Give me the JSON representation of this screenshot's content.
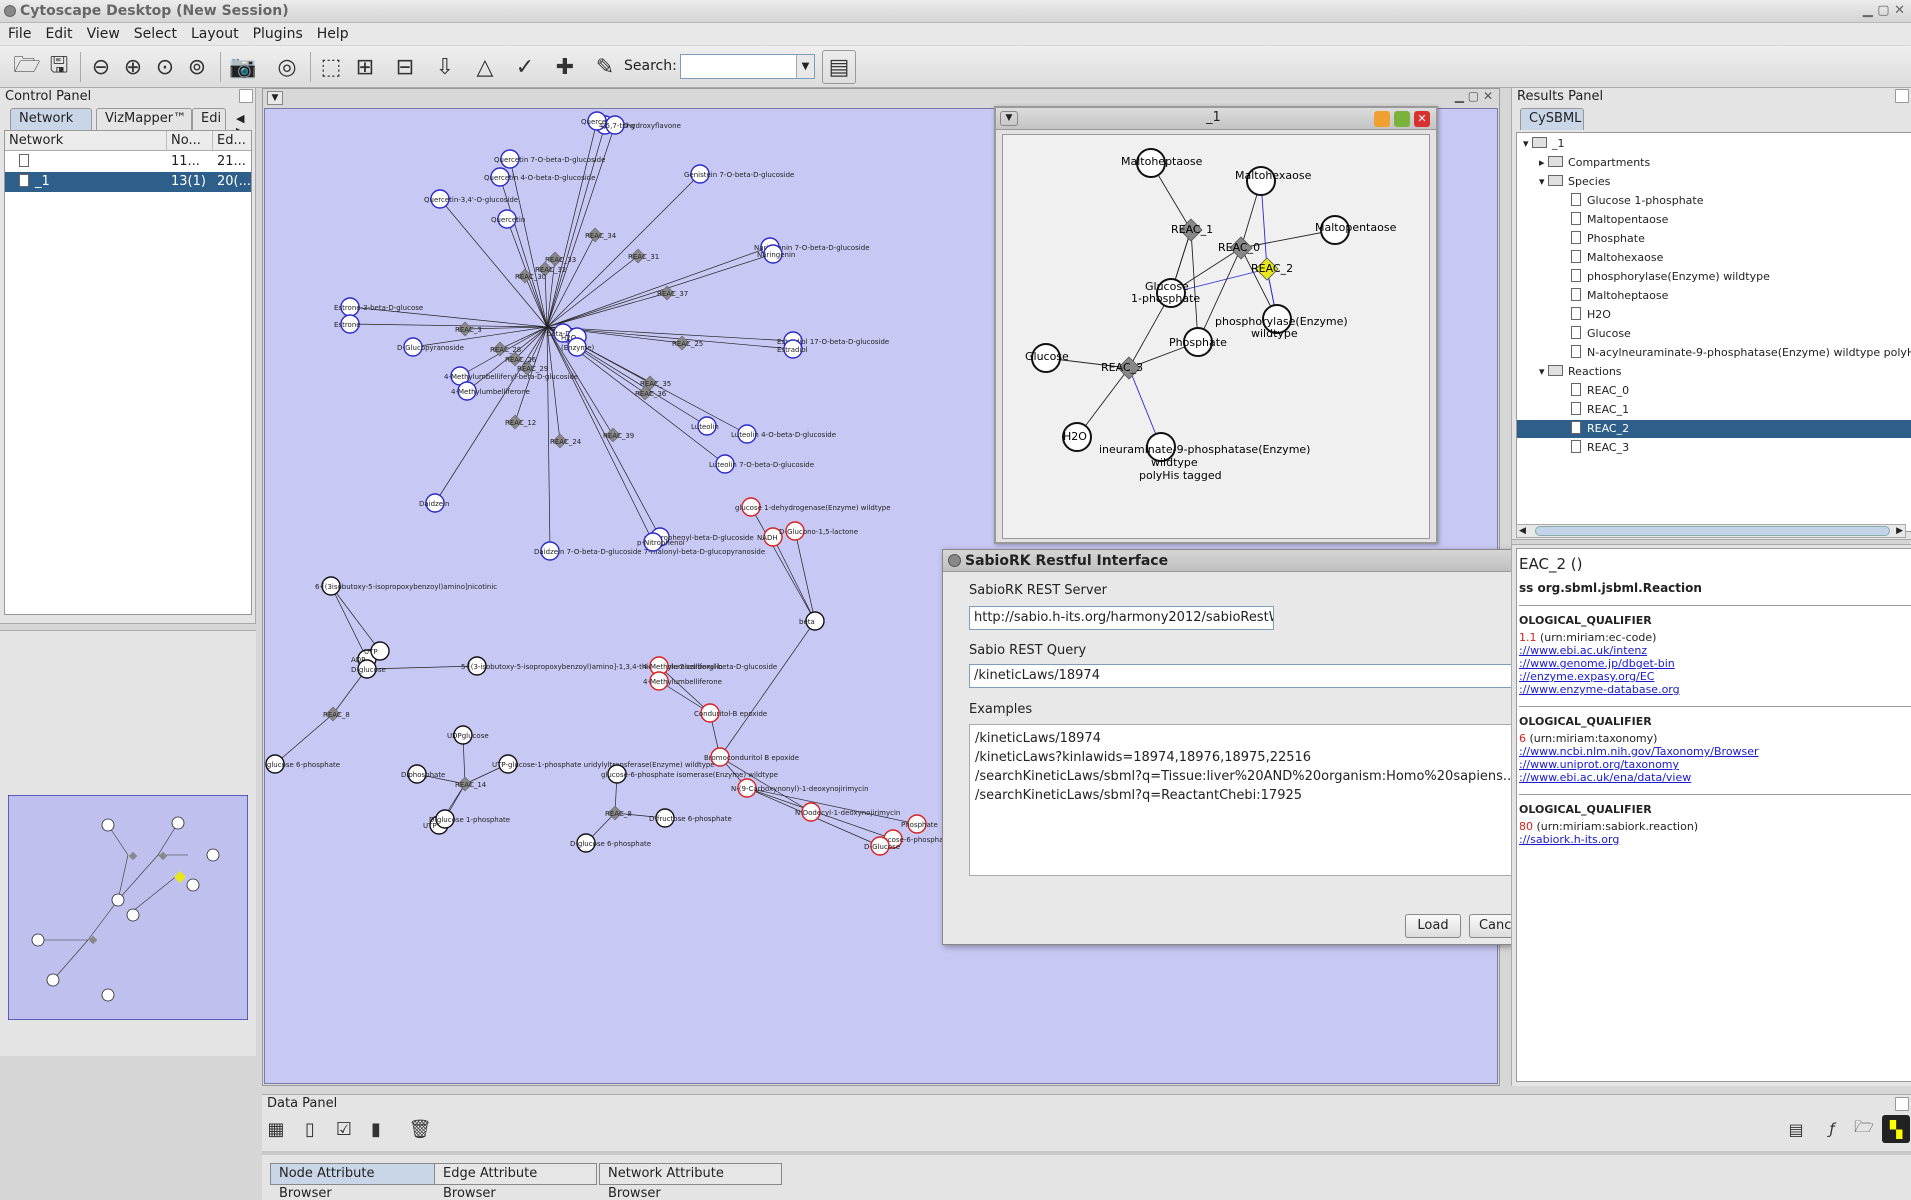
{
  "window": {
    "title": "Cytoscape Desktop (New Session)"
  },
  "menu": [
    "File",
    "Edit",
    "View",
    "Select",
    "Layout",
    "Plugins",
    "Help"
  ],
  "toolbar": {
    "search_label": "Search:",
    "search_value": ""
  },
  "control_panel": {
    "title": "Control Panel",
    "tabs": [
      "Network",
      "VizMapper™",
      "Edi"
    ],
    "table_headers": [
      "Network",
      "No...",
      "Ed..."
    ],
    "rows": [
      {
        "name": "",
        "nodes": "11...",
        "edges": "21..."
      },
      {
        "name": "_1",
        "nodes": "13(1)",
        "edges": "20(..."
      }
    ]
  },
  "subnet_window": {
    "title": "_1"
  },
  "main_graph": {
    "nodes": [
      "7-O-beta-D-g",
      "Quercetin",
      "4,5,7-trihydroxyflavone",
      "Quercetin 7-O-beta-D-glucoside",
      "Quercetin 4-O-beta-D-glucoside",
      "Quercetin-3,4'-O-glucoside",
      "Quercetin",
      "Genistein 7-O-beta-D-glucoside",
      "Naringenin 7-O-beta-D-glucoside",
      "Naringenin",
      "REAC_33",
      "REAC_34",
      "REAC_31",
      "REAC_32",
      "REAC_30",
      "REAC_37",
      "REAC_3",
      "REAC_35",
      "REAC_25",
      "REAC_28",
      "REAC_29",
      "REAC_26",
      "REAC_12",
      "REAC_24",
      "REAC_39",
      "REAC_36",
      "Estrone-3-beta-D-glucose",
      "Estrone",
      "D-Glucopyranoside",
      "4-Methylumbelliferyl-beta-D-glucoside",
      "4-Methylumbelliferone",
      "beta-D-",
      "H2O",
      "(Enzyme)",
      "Estradiol 17-O-beta-D-glucoside",
      "Estradiol",
      "Luteolin",
      "Luteolin 4-O-beta-D-glucoside",
      "Luteolin 7-O-beta-D-glucoside",
      "Daidzein",
      "Daidzein 7-O-beta-D-glucoside 7-malonyl-beta-D-glucopyranoside",
      "p-Nitrophenyl-beta-D-glucoside",
      "p-Nitrophenol",
      "6-[(3isobutoxy-5-isopropoxybenzoyl)amino]nicotinic",
      "5-[(3-isobutoxy-5-isopropoxybenzoyl)amino]-1,3,4-thiadiazole-2-carboxylic",
      "ADP",
      "UTP",
      "D-glucose",
      "REAC_8",
      "D-glucose 6-phosphate",
      "UDPglucose",
      "UTP-glucose-1-phosphate uridylyltransferase(Enzyme) wildtype",
      "Diphosphate",
      "REAC_14",
      "UTP",
      "D-glucose 1-phosphate",
      "glucose-6-phosphate isomerase(Enzyme) wildtype",
      "REAC_8",
      "D-glucose 6-phosphate",
      "D-fructose 6-phosphate",
      "4-Methylumbelliferyl-beta-D-glucoside",
      "4-Methylumbelliferone",
      "Conduritol-B epoxide",
      "Bromoconduritol B epoxide",
      "N-(9-Carboxynonyl)-1-deoxynojirimycin",
      "N-Dodecyl-1-deoxynojirimycin",
      "glucose 1-dehydrogenase(Enzyme) wildtype",
      "NADH",
      "D-Glucono-1,5-lactone",
      "beta",
      "glucose-6-phosphatase(Enzyme)",
      "Phosphate",
      "D-Glucose"
    ]
  },
  "sub_graph": {
    "nodes": [
      "Maltoheptaose",
      "Maltohexaose",
      "Maltopentaose",
      "REAC_1",
      "REAC_0",
      "REAC_2",
      "Glucose 1-phosphate",
      "phosphorylase(Enzyme) wildtype",
      "Phosphate",
      "Glucose",
      "REAC_3",
      "H2O",
      "N-acylneuraminate-9-phosphatase(Enzyme) wildtype polyHis tagged"
    ]
  },
  "dialog": {
    "title": "SabioRK Restful Interface",
    "server_label": "SabioRK REST Server",
    "server_value": "http://sabio.h-its.org/harmony2012/sabioRestW",
    "query_label": "Sabio REST Query",
    "query_value": "/kineticLaws/18974",
    "examples_label": "Examples",
    "examples": [
      "/kineticLaws/18974",
      "/kineticLaws?kinlawids=18974,18976,18975,22516",
      "/searchKineticLaws/sbml?q=Tissue:liver%20AND%20organism:Homo%20sapiens...",
      "/searchKineticLaws/sbml?q=ReactantChebi:17925"
    ],
    "load_button": "Load",
    "cancel_button": "Cancel"
  },
  "results_panel": {
    "title": "Results Panel",
    "tab": "CySBML",
    "tree": {
      "root": "_1",
      "compartments": "Compartments",
      "species_label": "Species",
      "species": [
        "Glucose 1-phosphate",
        "Maltopentaose",
        "Phosphate",
        "Maltohexaose",
        "phosphorylase(Enzyme) wildtype",
        "Maltoheptaose",
        "H2O",
        "Glucose",
        "N-acylneuraminate-9-phosphatase(Enzyme) wildtype polyHis tagged"
      ],
      "reactions_label": "Reactions",
      "reactions": [
        "REAC_0",
        "REAC_1",
        "REAC_2",
        "REAC_3"
      ]
    },
    "detail": {
      "heading": "EAC_2 ()",
      "class": "ss org.sbml.jsbml.Reaction",
      "blocks": [
        {
          "qualifier": "OLOGICAL_QUALIFIER",
          "id_prefix": "1.1",
          "id_text": "(urn:miriam:ec-code)",
          "links": [
            "://www.ebi.ac.uk/intenz",
            "://www.genome.jp/dbget-bin",
            "://enzyme.expasy.org/EC",
            "://www.enzyme-database.org"
          ]
        },
        {
          "qualifier": "OLOGICAL_QUALIFIER",
          "id_prefix": "6",
          "id_text": "(urn:miriam:taxonomy)",
          "links": [
            "://www.ncbi.nlm.nih.gov/Taxonomy/Browser",
            "://www.uniprot.org/taxonomy",
            "://www.ebi.ac.uk/ena/data/view"
          ]
        },
        {
          "qualifier": "OLOGICAL_QUALIFIER",
          "id_prefix": "80",
          "id_text": "(urn:miriam:sabiork.reaction)",
          "links": [
            "://sabiork.h-its.org"
          ]
        }
      ]
    }
  },
  "data_panel": {
    "title": "Data Panel",
    "tabs": [
      "Node Attribute Browser",
      "Edge Attribute Browser",
      "Network Attribute Browser"
    ]
  }
}
